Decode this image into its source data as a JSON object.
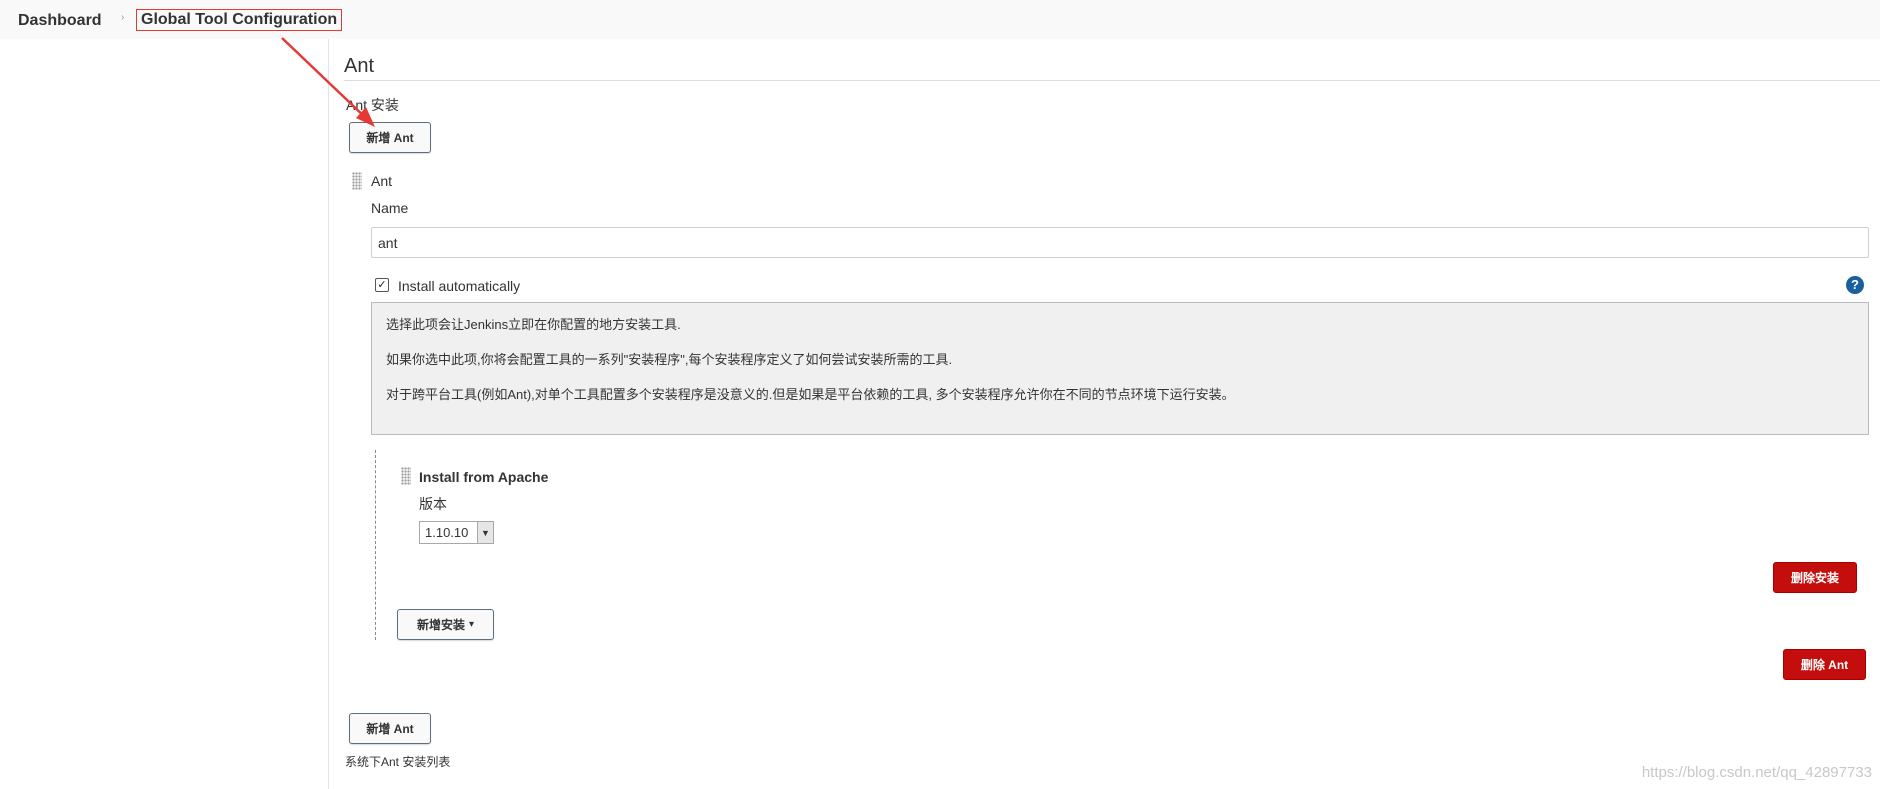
{
  "breadcrumb": {
    "items": [
      "Dashboard",
      "Global Tool Configuration"
    ],
    "separator": "›"
  },
  "ant_section": {
    "title": "Ant",
    "installations_label": "Ant 安装",
    "add_button_top": "新增 Ant",
    "installation": {
      "header": "Ant",
      "name_label": "Name",
      "name_value": "ant",
      "install_auto_label": "Install automatically",
      "install_auto_checked": true,
      "help_icon": "?",
      "help_text": [
        "选择此项会让Jenkins立即在你配置的地方安装工具.",
        "如果你选中此项,你将会配置工具的一系列\"安装程序\",每个安装程序定义了如何尝试安装所需的工具.",
        "对于跨平台工具(例如Ant),对单个工具配置多个安装程序是没意义的.但是如果是平台依赖的工具, 多个安装程序允许你在不同的节点环境下运行安装。"
      ],
      "installer": {
        "title": "Install from Apache",
        "version_label": "版本",
        "version_value": "1.10.10",
        "delete_installer_button": "删除安装",
        "add_installer_button": "新增安装",
        "add_installer_caret": "▾"
      },
      "delete_ant_button": "删除 Ant"
    },
    "add_button_bottom": "新增 Ant",
    "list_caption": "系统下Ant 安装列表"
  },
  "watermark": "https://blog.csdn.net/qq_42897733",
  "colors": {
    "danger": "#c40d0d",
    "annotation": "#e53935",
    "help_icon": "#1b5f9e"
  }
}
